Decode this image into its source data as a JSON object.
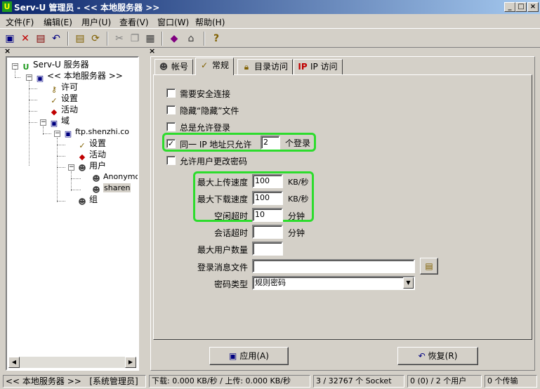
{
  "window": {
    "title": "Serv-U 管理员 - << 本地服务器 >>",
    "app_icon": "serv-u-icon",
    "min_label": "_",
    "max_label": "□",
    "close_label": "×"
  },
  "menu": [
    "文件(F)",
    "编辑(E)",
    "用户(U)",
    "查看(V)",
    "窗口(W)",
    "帮助(H)"
  ],
  "left_pane": {
    "close_label": "×",
    "tree": {
      "root": "Serv-U 服务器",
      "server": "<< 本地服务器 >>",
      "license": "许可",
      "settings": "设置",
      "activity": "活动",
      "domains": "域",
      "domain": "ftp.shenzhi.co",
      "domain_settings": "设置",
      "domain_activity": "活动",
      "users": "用户",
      "user_anonymous": "Anonymou",
      "user_sharen": "sharen",
      "groups": "组"
    }
  },
  "right_pane": {
    "close_label": "×",
    "tabs": [
      "帐号",
      "常规",
      "目录访问",
      "IP 访问"
    ],
    "active_tab": "常规",
    "options": {
      "secure_conn": "需要安全连接",
      "hide_hidden": "隐藏“隐藏”文件",
      "always_allow": "总是允许登录",
      "same_ip": "同一 IP 地址只允许",
      "same_ip_checked": "✓",
      "same_ip_value": "2",
      "same_ip_unit": "个登录",
      "allow_change_pw": "允许用户更改密码"
    },
    "limits": {
      "upload_label": "最大上传速度",
      "upload_value": "100",
      "upload_unit": "KB/秒",
      "download_label": "最大下载速度",
      "download_value": "100",
      "download_unit": "KB/秒",
      "idle_label": "空闲超时",
      "idle_value": "10",
      "idle_unit": "分钟",
      "session_label": "会话超时",
      "session_value": "",
      "session_unit": "分钟",
      "max_users_label": "最大用户数量",
      "max_users_value": "",
      "login_msg_label": "登录消息文件",
      "login_msg_value": "",
      "pw_type_label": "密码类型",
      "pw_type_value": "规则密码"
    },
    "buttons": {
      "apply": "应用(A)",
      "restore": "恢复(R)"
    }
  },
  "status": {
    "server": "<< 本地服务器 >>",
    "role": "[系统管理员]",
    "transfer": "下载: 0.000 KB/秒 / 上传: 0.000 KB/秒",
    "sockets": "3 / 32767 个 Socket",
    "users": "0 (0) / 2 个用户",
    "transfers": "0 个传输"
  },
  "colors": {
    "highlight": "#2ddc2d",
    "titlebar": "#0a246a"
  }
}
